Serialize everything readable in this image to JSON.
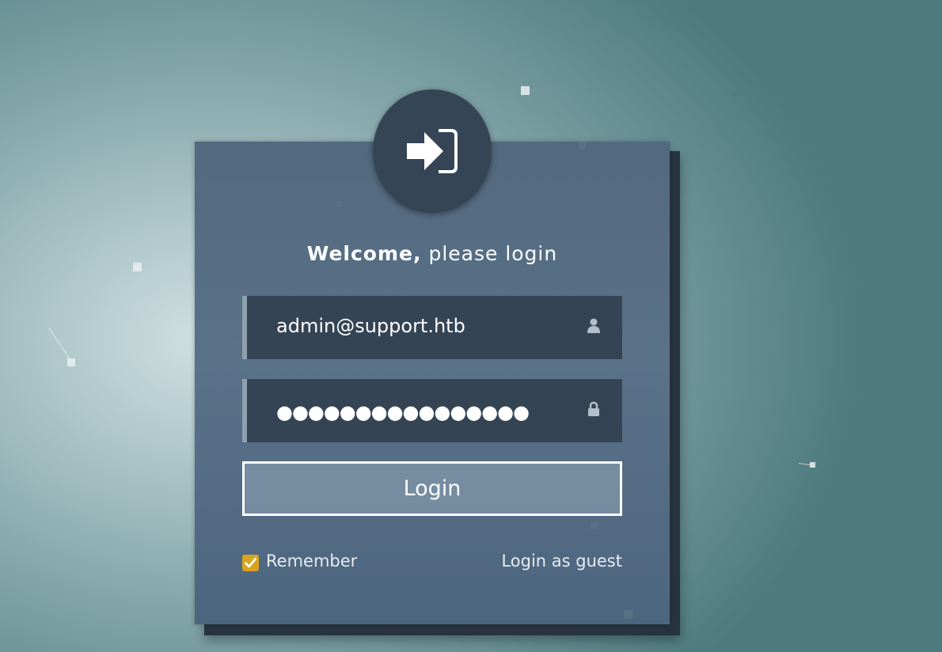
{
  "header": {
    "title_bold": "Welcome,",
    "title_rest": " please login"
  },
  "form": {
    "email_value": "admin@support.htb",
    "password_mask": "●●●●●●●●●●●●●●●●",
    "login_label": "Login",
    "remember_label": "Remember",
    "remember_checked": true,
    "guest_label": "Login as guest"
  },
  "icons": {
    "avatar": "sign-in-icon",
    "email": "user-icon",
    "password": "lock-icon",
    "checkbox": "check-icon"
  },
  "colors": {
    "accent_checkbox": "#d9a41f",
    "field_bg": "#354455",
    "circle_bg": "#354556"
  }
}
